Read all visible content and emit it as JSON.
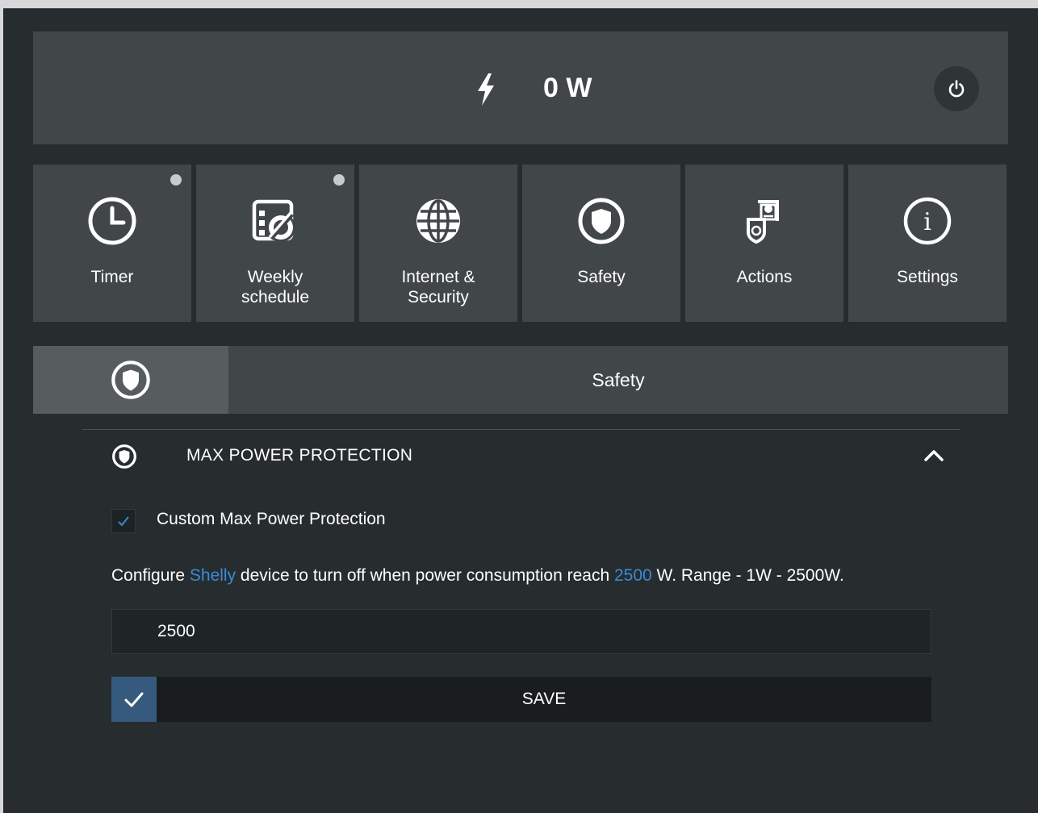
{
  "header": {
    "power_value": "0 W",
    "power_icon": "lightning-bolt-icon",
    "toggle_icon": "power-icon"
  },
  "tiles": [
    {
      "label": "Timer",
      "icon": "clock-icon",
      "has_indicator": true
    },
    {
      "label": "Weekly schedule",
      "icon": "weekly-schedule-icon",
      "has_indicator": true
    },
    {
      "label": "Internet & Security",
      "icon": "globe-icon",
      "has_indicator": false
    },
    {
      "label": "Safety",
      "icon": "shield-icon",
      "has_indicator": false
    },
    {
      "label": "Actions",
      "icon": "actions-icon",
      "has_indicator": false
    },
    {
      "label": "Settings",
      "icon": "info-icon",
      "has_indicator": false
    }
  ],
  "section": {
    "title": "Safety",
    "icon": "shield-icon"
  },
  "max_power": {
    "title": "MAX POWER PROTECTION",
    "expanded": true,
    "checkbox_label": "Custom Max Power Protection",
    "checkbox_checked": true,
    "description": {
      "prefix": "Configure ",
      "device": "Shelly",
      "middle": " device to turn off when power consumption reach ",
      "value": "2500",
      "suffix": " W. Range - 1W - 2500W."
    },
    "input_value": "2500",
    "save_label": "SAVE"
  },
  "colors": {
    "background": "#272c2f",
    "panel": "#414649",
    "accent": "#3a8ad6",
    "save_check": "#355a7e"
  }
}
